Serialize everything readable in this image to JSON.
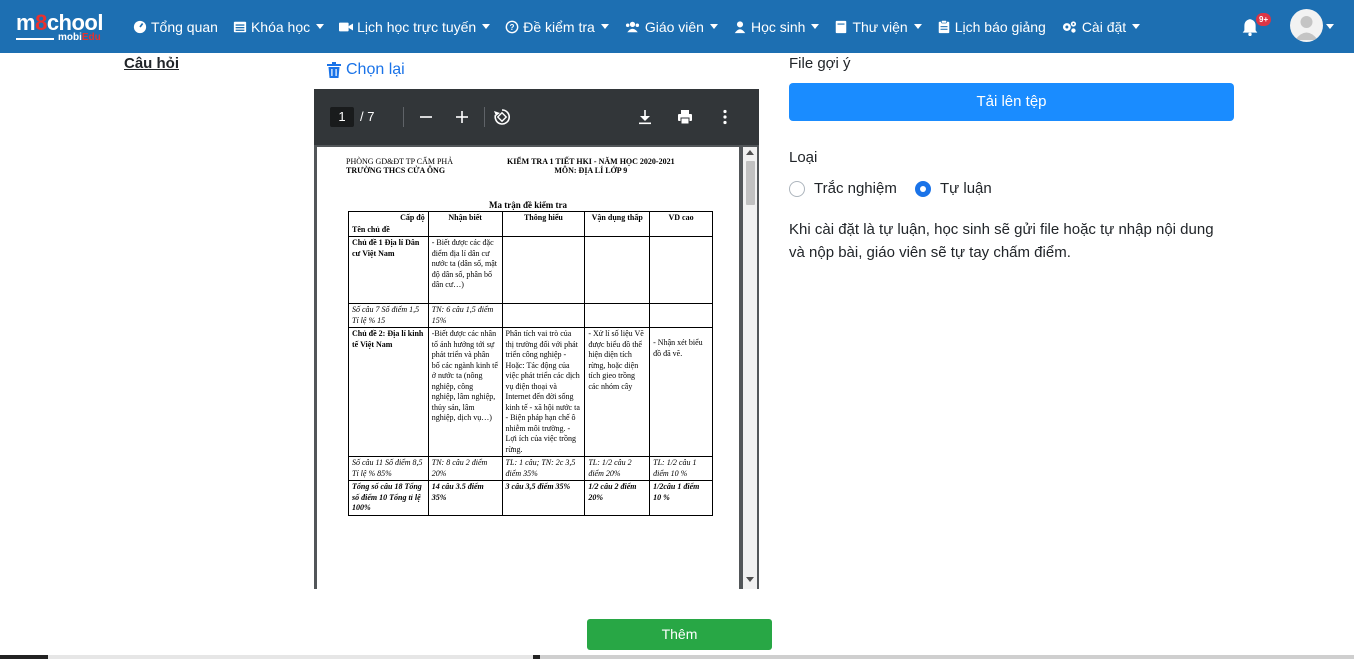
{
  "brand": {
    "logo_main_a": "m",
    "logo_main_o": "8",
    "logo_main_b": "chool",
    "logo_sub_a": "mobi",
    "logo_sub_b": "Edu"
  },
  "nav": {
    "items": [
      {
        "label": "Tổng quan",
        "icon": "dashboard-icon",
        "has_caret": false
      },
      {
        "label": "Khóa học",
        "icon": "list-icon",
        "has_caret": true
      },
      {
        "label": "Lịch học trực tuyến",
        "icon": "video-icon",
        "has_caret": true
      },
      {
        "label": "Đề kiểm tra",
        "icon": "question-circle-icon",
        "has_caret": true
      },
      {
        "label": "Giáo viên",
        "icon": "users-icon",
        "has_caret": true
      },
      {
        "label": "Học sinh",
        "icon": "user-icon",
        "has_caret": true
      },
      {
        "label": "Thư viện",
        "icon": "book-icon",
        "has_caret": true
      },
      {
        "label": "Lịch báo giảng",
        "icon": "clipboard-icon",
        "has_caret": false
      },
      {
        "label": "Cài đặt",
        "icon": "cogs-icon",
        "has_caret": true
      }
    ],
    "notification_badge": "9+"
  },
  "question": {
    "label": "Câu hỏi",
    "reselect_label": "Chọn lại"
  },
  "pdf": {
    "current_page": "1",
    "total_pages": "/ 7",
    "head_left_1": "PHÒNG GD&ĐT TP CẨM PHẢ",
    "head_left_2": "TRƯỜNG THCS CỬA ÔNG",
    "head_right_1": "KIỂM TRA 1 TIẾT HKI - NĂM HỌC 2020-2021",
    "head_right_2": "MÔN: ĐỊA LÍ LỚP 9",
    "table_title": "Ma trận đề kiểm tra",
    "table": {
      "corner_top": "Cấp độ",
      "corner_bottom": "Tên chủ đề",
      "headers": [
        "Nhận biết",
        "Thông hiểu",
        "Vận dụng thấp",
        "VD cao"
      ],
      "rows": [
        [
          "Chủ đề 1 Địa lí Dân cư Việt Nam",
          "- Biết được các đặc điểm địa lí dân cư nước ta (dân số, mật độ dân số, phân bố dân cư…)",
          "",
          "",
          ""
        ],
        [
          "Số câu 7 Số điểm 1,5 Tỉ lệ % 15",
          "TN: 6 câu 1,5 điểm 15%",
          "",
          "",
          ""
        ],
        [
          "Chủ đề 2: Địa lí kinh tế Việt Nam",
          "-Biết được các nhân tố ảnh hưởng tới sự phát triển và phân bố các ngành kinh tế ở nước ta (nông nghiệp, công nghiệp, lâm nghiệp, thủy sản, lâm nghiệp, dịch vụ…)",
          "Phân tích vai trò của thị trường đối với phát triển công nghiệp - Hoặc: Tác động của việc phát triển các dịch vụ điện thoại và Internet đến đời sống kinh tế - xã hội nước ta - Biện pháp hạn chế ô nhiễm môi trường. - Lợi ích của việc trồng rừng.",
          "- Xử lí số liệu Vẽ được biểu đồ thể hiện diện tích rừng, hoặc diện tích gieo trồng các nhóm cây",
          "- Nhận xét biểu đồ đã vẽ."
        ],
        [
          "Số câu 11 Số điểm 8,5 Tỉ lệ % 85%",
          "TN: 8 câu 2 điểm 20%",
          "TL: 1 câu; TN: 2c 3,5 điểm 35%",
          "TL: 1/2 câu 2 điểm 20%",
          "TL: 1/2 câu 1 điểm 10 %"
        ],
        [
          "Tổng số câu 18 Tổng số điểm 10 Tổng tỉ lệ 100%",
          "14 câu 3.5 điểm 35%",
          "3 câu 3,5 điểm 35%",
          "1/2 câu 2 điểm 20%",
          "1/2câu 1 điểm 10 %"
        ]
      ]
    }
  },
  "sidebar": {
    "hint_label": "File gợi ý",
    "upload_label": "Tải lên tệp",
    "type_label": "Loại",
    "option_mc": "Trắc nghiệm",
    "option_essay": "Tự luận",
    "selected_option": "Tự luận",
    "info": "Khi cài đặt là tự luận, học sinh sẽ gửi file hoặc tự nhập nội dung và nộp bài, giáo viên sẽ tự tay chấm điểm."
  },
  "actions": {
    "add_label": "Thêm"
  },
  "colors": {
    "navbar": "#1d6fb2",
    "primary": "#1a8cff",
    "success": "#28a745",
    "danger": "#dc3545"
  }
}
